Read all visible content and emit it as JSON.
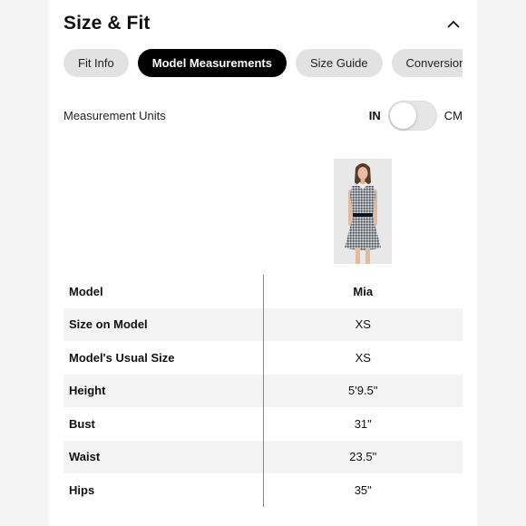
{
  "section": {
    "title": "Size & Fit"
  },
  "tabs": [
    {
      "label": "Fit Info",
      "active": false
    },
    {
      "label": "Model Measurements",
      "active": true
    },
    {
      "label": "Size Guide",
      "active": false
    },
    {
      "label": "Conversion",
      "active": false
    }
  ],
  "units": {
    "label": "Measurement Units",
    "option_in": "IN",
    "option_cm": "CM",
    "selected": "IN"
  },
  "icons": {
    "collapse": "chevron-up-icon"
  },
  "model_image": {
    "alt": "Model wearing gingham sleeveless dress"
  },
  "table": {
    "header": {
      "label": "Model",
      "value": "Mia"
    },
    "rows": [
      {
        "label": "Size on Model",
        "value": "XS"
      },
      {
        "label": "Model's Usual Size",
        "value": "XS"
      },
      {
        "label": "Height",
        "value": "5'9.5\""
      },
      {
        "label": "Bust",
        "value": "31\""
      },
      {
        "label": "Waist",
        "value": "23.5\""
      },
      {
        "label": "Hips",
        "value": "35\""
      }
    ]
  },
  "colors": {
    "active_tab": "#000000",
    "inactive_tab": "#e2e2e2",
    "page_background": "#f4f4f4",
    "row_stripe": "#f3f3f3"
  }
}
